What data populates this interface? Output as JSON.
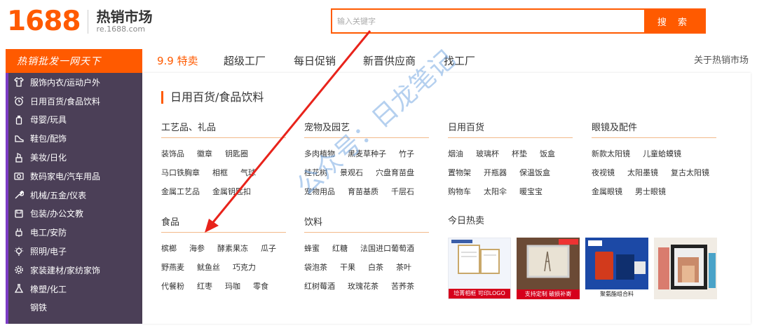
{
  "header": {
    "logo_number": "1688",
    "logo_title": "热销市场",
    "logo_url": "re.1688.com",
    "search_placeholder": "输入关键字",
    "search_button": "搜 索"
  },
  "nav": {
    "category_label": "热销批发一网天下",
    "items": [
      "9.9 特卖",
      "超级工厂",
      "每日促销",
      "新晋供应商",
      "找工厂"
    ],
    "about": "关于热销市场"
  },
  "sidebar": {
    "items": [
      {
        "icon": "shirt-icon",
        "label": "服饰内衣/运动户外"
      },
      {
        "icon": "alarm-clock-icon",
        "label": "日用百货/食品饮料"
      },
      {
        "icon": "baby-bottle-icon",
        "label": "母婴/玩具"
      },
      {
        "icon": "shoe-icon",
        "label": "鞋包/配饰"
      },
      {
        "icon": "lipstick-icon",
        "label": "美妆/日化"
      },
      {
        "icon": "camera-icon",
        "label": "数码家电/汽车用品"
      },
      {
        "icon": "wrench-icon",
        "label": "机械/五金/仪表"
      },
      {
        "icon": "box-icon",
        "label": "包装/办公文教"
      },
      {
        "icon": "plug-icon",
        "label": "电工/安防"
      },
      {
        "icon": "bulb-icon",
        "label": "照明/电子"
      },
      {
        "icon": "gear-icon",
        "label": "家装建材/家纺家饰"
      },
      {
        "icon": "flask-icon",
        "label": "橡塑/化工"
      },
      {
        "icon": "",
        "label": "钢铁"
      }
    ]
  },
  "panel": {
    "title": "日用百货/食品饮料",
    "categories": [
      {
        "head": "工艺品、礼品",
        "links": [
          "装饰品",
          "徽章",
          "钥匙圈",
          "马口铁胸章",
          "相框",
          "气球",
          "金属工艺品",
          "金属钥匙扣"
        ]
      },
      {
        "head": "宠物及园艺",
        "links": [
          "多肉植物",
          "黑麦草种子",
          "竹子",
          "桂花树",
          "景观石",
          "穴盘育苗盘",
          "宠物用品",
          "育苗基质",
          "千层石"
        ]
      },
      {
        "head": "日用百货",
        "links": [
          "烟油",
          "玻璃杯",
          "杯垫",
          "饭盒",
          "置物架",
          "开瓶器",
          "保温饭盒",
          "购物车",
          "太阳伞",
          "暖宝宝"
        ]
      },
      {
        "head": "眼镜及配件",
        "links": [
          "新款太阳镜",
          "儿童蛤蟆镜",
          "夜视镜",
          "太阳墨镜",
          "复古太阳镜",
          "金属眼镜",
          "男士眼镜"
        ]
      },
      {
        "head": "食品",
        "links": [
          "槟榔",
          "海参",
          "酵素果冻",
          "瓜子",
          "野燕麦",
          "鱿鱼丝",
          "巧克力",
          "代餐粉",
          "红枣",
          "玛咖",
          "零食"
        ]
      },
      {
        "head": "饮料",
        "links": [
          "蜂蜜",
          "红糖",
          "法国进口葡萄酒",
          "袋泡茶",
          "干果",
          "白茶",
          "茶叶",
          "红树莓酒",
          "玫瑰花茶",
          "苦荞茶"
        ]
      }
    ],
    "today_hot": {
      "head": "今日热卖",
      "images": [
        {
          "name": "certificate-frame-image",
          "caption": "培菁相框 可印LOGO"
        },
        {
          "name": "acrylic-frame-image",
          "caption": "支持定制 破损补寄"
        },
        {
          "name": "oil-drum-box-image",
          "caption": "聚氨酯组合料"
        },
        {
          "name": "picture-frame-image",
          "caption": ""
        }
      ]
    }
  },
  "overlay": {
    "watermark": "公众号：日龙笔记"
  },
  "colors": {
    "brand_orange": "#ff5a00",
    "sidebar_bg": "#4b3f57",
    "sidebar_accent": "#7b3bc4",
    "arrow_red": "#e8231b"
  }
}
